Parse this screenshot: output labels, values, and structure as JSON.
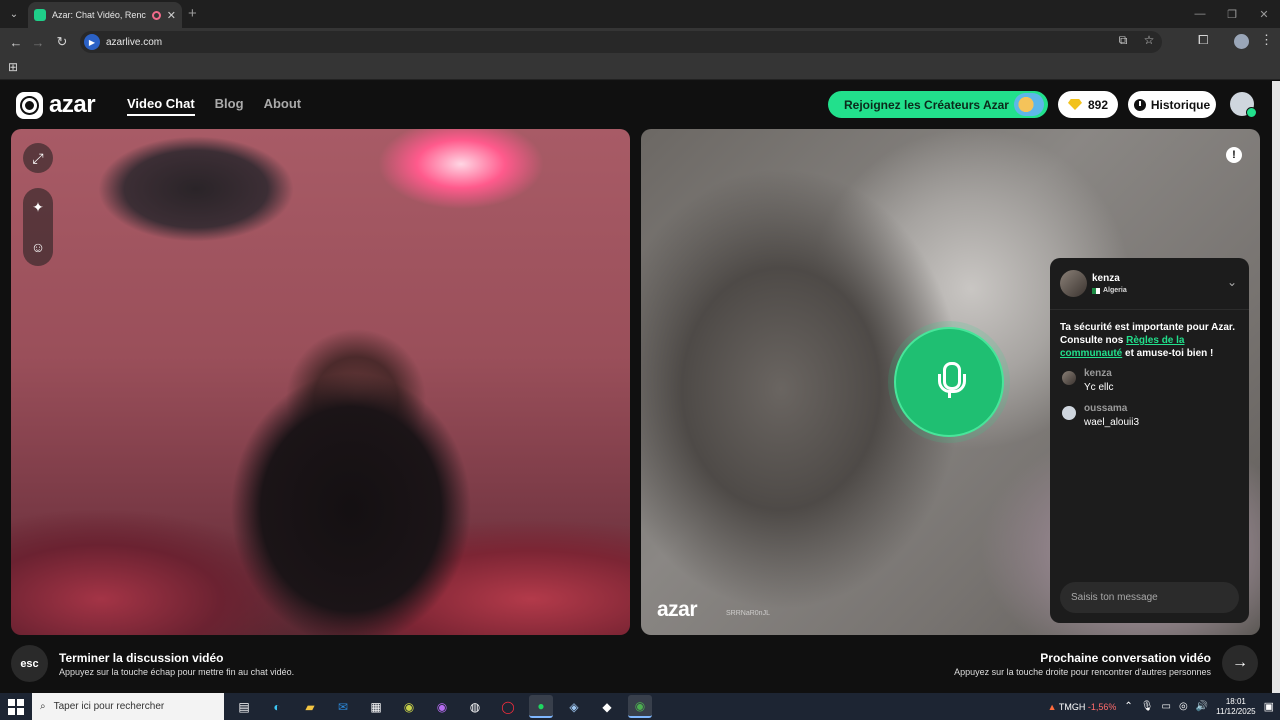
{
  "browser": {
    "tab_title": "Azar: Chat Vidéo, Rencontre",
    "new_tab_symbol": "+",
    "url": "azarlive.com",
    "window_controls": [
      "—",
      "❐",
      "✕"
    ]
  },
  "header": {
    "logo_text": "azar",
    "nav": [
      {
        "label": "Video Chat",
        "active": true
      },
      {
        "label": "Blog",
        "active": false
      },
      {
        "label": "About",
        "active": false
      }
    ],
    "creators_cta": "Rejoignez les Créateurs Azar",
    "gems_count": "892",
    "history_label": "Historique"
  },
  "remote_video": {
    "watermark_logo": "azar",
    "watermark_id": "SRRNaR0nJL",
    "report_symbol": "!"
  },
  "chat": {
    "partner_name": "kenza",
    "partner_country": "Algeria",
    "safety_prefix": "Ta sécurité est importante pour Azar. Consulte nos ",
    "safety_link": "Règles de la communauté",
    "safety_suffix": " et amuse-toi bien !",
    "messages": [
      {
        "author": "kenza",
        "text": "Yc ellc"
      },
      {
        "author": "oussama",
        "text": "wael_alouii3"
      }
    ],
    "input_placeholder": "Saisis ton message"
  },
  "footer": {
    "esc_label": "esc",
    "end_title": "Terminer la discussion vidéo",
    "end_hint": "Appuyez sur la touche échap pour mettre fin au chat vidéo.",
    "next_title": "Prochaine conversation vidéo",
    "next_hint": "Appuyez sur la touche droite pour rencontrer d'autres personnes",
    "next_symbol": "→"
  },
  "taskbar": {
    "search_placeholder": "Taper ici pour rechercher",
    "ticker_name": "TMGH",
    "ticker_change": "-1,56%",
    "time": "18:01",
    "date": "11/12/2025"
  },
  "colors": {
    "accent_green": "#22e08c",
    "mic_green": "#1fbf72",
    "page_bg": "#101010",
    "chat_bg": "#1c1c1c"
  }
}
